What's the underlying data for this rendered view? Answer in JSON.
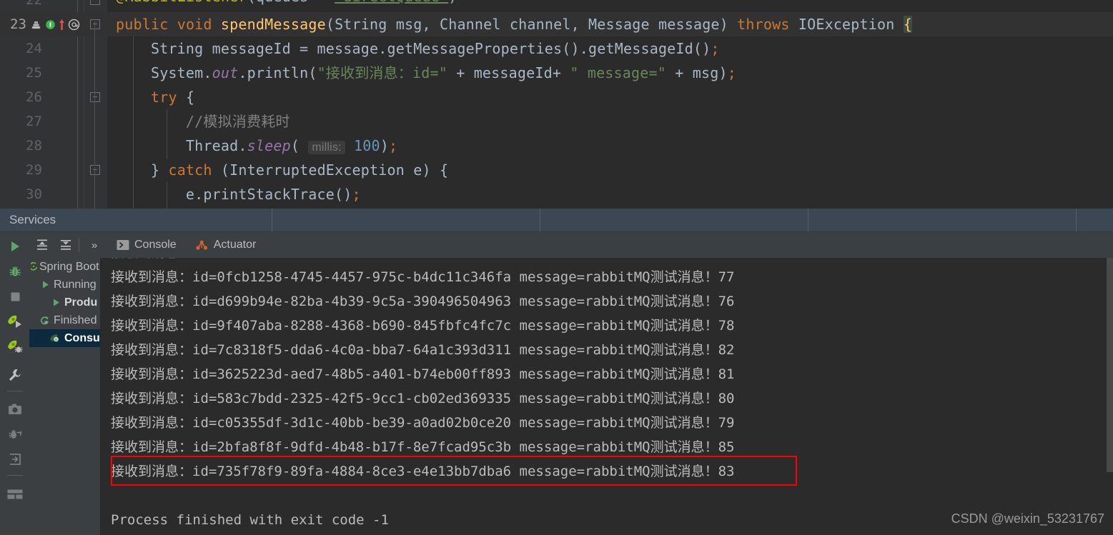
{
  "editor": {
    "lines": [
      {
        "number": "22",
        "partial": true,
        "tokens": [
          {
            "t": "@RabbitListener",
            "c": "ann"
          },
          {
            "t": "(queues = ",
            "c": "pun"
          },
          {
            "t": "\"directQueue\"",
            "c": "str"
          },
          {
            "t": ")",
            "c": "pun"
          }
        ]
      },
      {
        "number": "23",
        "current": true,
        "fold": true,
        "gutter_icons": [
          "override-method-icon",
          "breakpoint-icon",
          "run-arrow-icon",
          "annotation-icon"
        ],
        "tokens": [
          {
            "t": "public",
            "c": "kw"
          },
          {
            "t": " ",
            "c": "pun"
          },
          {
            "t": "void",
            "c": "kw"
          },
          {
            "t": " ",
            "c": "pun"
          },
          {
            "t": "spendMessage",
            "c": "mth"
          },
          {
            "t": "(String msg, Channel channel, Message message) ",
            "c": "pun"
          },
          {
            "t": "throws",
            "c": "kw"
          },
          {
            "t": " IOException ",
            "c": "pun"
          },
          {
            "t": "{",
            "c": "caret"
          }
        ]
      },
      {
        "number": "24",
        "tokens": [
          {
            "t": "    String messageId = message.getMessageProperties().getMessageId()",
            "c": "pun"
          },
          {
            "t": ";",
            "c": "semi"
          }
        ]
      },
      {
        "number": "25",
        "tokens": [
          {
            "t": "    System.",
            "c": "pun"
          },
          {
            "t": "out",
            "c": "fld"
          },
          {
            "t": ".println(",
            "c": "pun"
          },
          {
            "t": "\"接收到消息：id=\"",
            "c": "str"
          },
          {
            "t": " + messageId+ ",
            "c": "pun"
          },
          {
            "t": "\" message=\"",
            "c": "str"
          },
          {
            "t": " + msg)",
            "c": "pun"
          },
          {
            "t": ";",
            "c": "semi"
          }
        ]
      },
      {
        "number": "26",
        "fold": true,
        "tokens": [
          {
            "t": "    ",
            "c": "pun"
          },
          {
            "t": "try",
            "c": "kw"
          },
          {
            "t": " {",
            "c": "pun"
          }
        ]
      },
      {
        "number": "27",
        "tokens": [
          {
            "t": "        //模拟消费耗时",
            "c": "cmt"
          }
        ]
      },
      {
        "number": "28",
        "hint": "millis:",
        "tokens": [
          {
            "t": "        Thread.",
            "c": "pun"
          },
          {
            "t": "sleep",
            "c": "mi"
          },
          {
            "t": "(",
            "c": "pun"
          },
          {
            "t": "__HINT__",
            "c": "hint"
          },
          {
            "t": "100",
            "c": "num"
          },
          {
            "t": ")",
            "c": "pun"
          },
          {
            "t": ";",
            "c": "semi"
          }
        ]
      },
      {
        "number": "29",
        "fold": true,
        "tokens": [
          {
            "t": "    } ",
            "c": "pun"
          },
          {
            "t": "catch",
            "c": "kw"
          },
          {
            "t": " (InterruptedException e) {",
            "c": "pun"
          }
        ]
      },
      {
        "number": "30",
        "tokens": [
          {
            "t": "        e.printStackTrace()",
            "c": "pun"
          },
          {
            "t": ";",
            "c": "semi"
          }
        ]
      }
    ]
  },
  "services_header": {
    "title": "Services"
  },
  "toolbar": {
    "buttons": [
      {
        "name": "rerun-button",
        "icon": "play-icon"
      },
      {
        "name": "scroll-to-end-button",
        "icon": "scroll-end-icon"
      },
      {
        "name": "soft-wrap-button",
        "icon": "soft-wrap-icon"
      },
      {
        "name": "more-actions-button",
        "icon": "chevron-double-right-icon",
        "label": "»"
      }
    ]
  },
  "tabs": [
    {
      "label": "Console",
      "icon": "console-icon",
      "active": true
    },
    {
      "label": "Actuator",
      "icon": "actuator-icon",
      "active": false
    }
  ],
  "vertical_toolbar": [
    {
      "name": "run-button",
      "icon": "play-green-icon"
    },
    {
      "name": "debug-button",
      "icon": "bug-green-icon"
    },
    {
      "name": "stop-button",
      "icon": "stop-square-icon"
    },
    {
      "name": "run-service-button",
      "icon": "rocket-run-icon"
    },
    {
      "name": "debug-service-button",
      "icon": "rocket-debug-icon"
    },
    {
      "name": "settings-wrench-button",
      "icon": "wrench-icon"
    },
    {
      "name": "capture-memory-snapshot-button",
      "icon": "camera-icon"
    },
    {
      "name": "attach-debugger-button",
      "icon": "attach-debugger-icon"
    },
    {
      "name": "enter-button",
      "icon": "enter-arrow-icon"
    },
    {
      "name": "layout-button",
      "icon": "layout-icon"
    }
  ],
  "service_tree": [
    {
      "label": "Spring Boot",
      "indent": 0,
      "icon": "spring-boot-icon",
      "selected": false,
      "bold": false
    },
    {
      "label": "Running",
      "indent": 1,
      "icon": "run-green-arrow-icon",
      "selected": false,
      "bold": false
    },
    {
      "label": "Produ",
      "indent": 2,
      "icon": "run-green-arrow-icon",
      "selected": false,
      "bold": true
    },
    {
      "label": "Finished",
      "indent": 1,
      "icon": "rerun-green-icon",
      "selected": false,
      "bold": false
    },
    {
      "label": "Consu",
      "indent": 2,
      "icon": "finished-service-icon",
      "selected": true,
      "bold": true
    }
  ],
  "console": {
    "lines": [
      "接收到消息：id=0fcb1258-4745-4457-975c-b4dc11c346fa message=rabbitMQ测试消息！77",
      "接收到消息：id=d699b94e-82ba-4b39-9c5a-390496504963 message=rabbitMQ测试消息！76",
      "接收到消息：id=9f407aba-8288-4368-b690-845fbfc4fc7c message=rabbitMQ测试消息！78",
      "接收到消息：id=7c8318f5-dda6-4c0a-bba7-64a1c393d311 message=rabbitMQ测试消息！82",
      "接收到消息：id=3625223d-aed7-48b5-a401-b74eb00ff893 message=rabbitMQ测试消息！81",
      "接收到消息：id=583c7bdd-2325-42f5-9cc1-cb02ed369335 message=rabbitMQ测试消息！80",
      "接收到消息：id=c05355df-3d1c-40bb-be39-a0ad02b0ce20 message=rabbitMQ测试消息！79",
      "接收到消息：id=2bfa8f8f-9dfd-4b48-b17f-8e7fcad95c3b message=rabbitMQ测试消息！85",
      "接收到消息：id=735f78f9-89fa-4884-8ce3-e4e13bb7dba6 message=rabbitMQ测试消息！83"
    ],
    "highlighted_line_index": 8,
    "highlight_color": "#ff0000",
    "exit_line": "Process finished with exit code -1"
  },
  "watermark": "CSDN @weixin_53231767"
}
